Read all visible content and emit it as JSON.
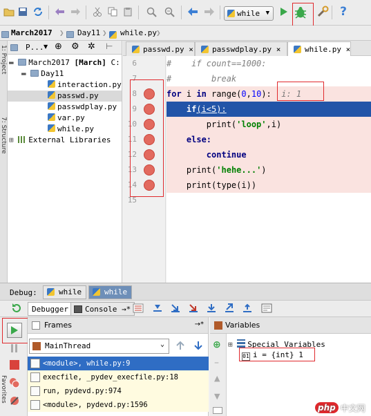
{
  "toolbar": {
    "run_config": "while",
    "help_label": "?"
  },
  "breadcrumb": {
    "project": "March2017",
    "folder": "Day11",
    "file": "while.py"
  },
  "project_panel": {
    "header_label": "P...",
    "side_label": "1: Project",
    "side_label2": "7: Structure",
    "root": "March2017",
    "root_tag": "[March]",
    "root_path": "C:",
    "folder": "Day11",
    "files": [
      "interaction.py",
      "passwd.py",
      "passwdplay.py",
      "var.py",
      "while.py"
    ],
    "external": "External Libraries"
  },
  "editor": {
    "tabs": [
      {
        "label": "passwd.py",
        "close": "×"
      },
      {
        "label": "passwdplay.py",
        "close": "×"
      },
      {
        "label": "while.py",
        "close": "×"
      }
    ],
    "line_numbers": [
      "6",
      "7",
      "8",
      "9",
      "10",
      "11",
      "12",
      "13",
      "14",
      "15"
    ],
    "lines": {
      "l6": "#    if count==1000:",
      "l7": "#        break",
      "l8_kw1": "for",
      "l8_a": " i ",
      "l8_kw2": "in",
      "l8_b": " range(",
      "l8_n1": "0",
      "l8_c": ",",
      "l8_n2": "10",
      "l8_d": "):",
      "l8_inline": "i: 1",
      "l9_kw": "if",
      "l9_rest": "(i<5):",
      "l10_a": "print(",
      "l10_s": "'loop'",
      "l10_b": ",i)",
      "l11_kw": "else:",
      "l12_kw": "continue",
      "l13_a": "print(",
      "l13_s": "'hehe...'",
      "l13_b": ")",
      "l14": "print(type(i))"
    }
  },
  "debug": {
    "label": "Debug:",
    "tabs": [
      "while",
      "while"
    ],
    "debugger_tab": "Debugger",
    "console_tab": "Console",
    "console_arrow": "→*",
    "frames_title": "Frames",
    "frames_pin": "→*",
    "thread": "MainThread",
    "frames": [
      "<module>, while.py:9",
      "execfile, _pydev_execfile.py:18",
      "run, pydevd.py:974",
      "<module>, pydevd.py:1596"
    ],
    "variables_title": "Variables",
    "special_vars": "Special Variables",
    "var_i": "i = {int} 1",
    "side_label": "Favorites"
  },
  "watermark": {
    "text": "中文网",
    "logo": "php"
  }
}
